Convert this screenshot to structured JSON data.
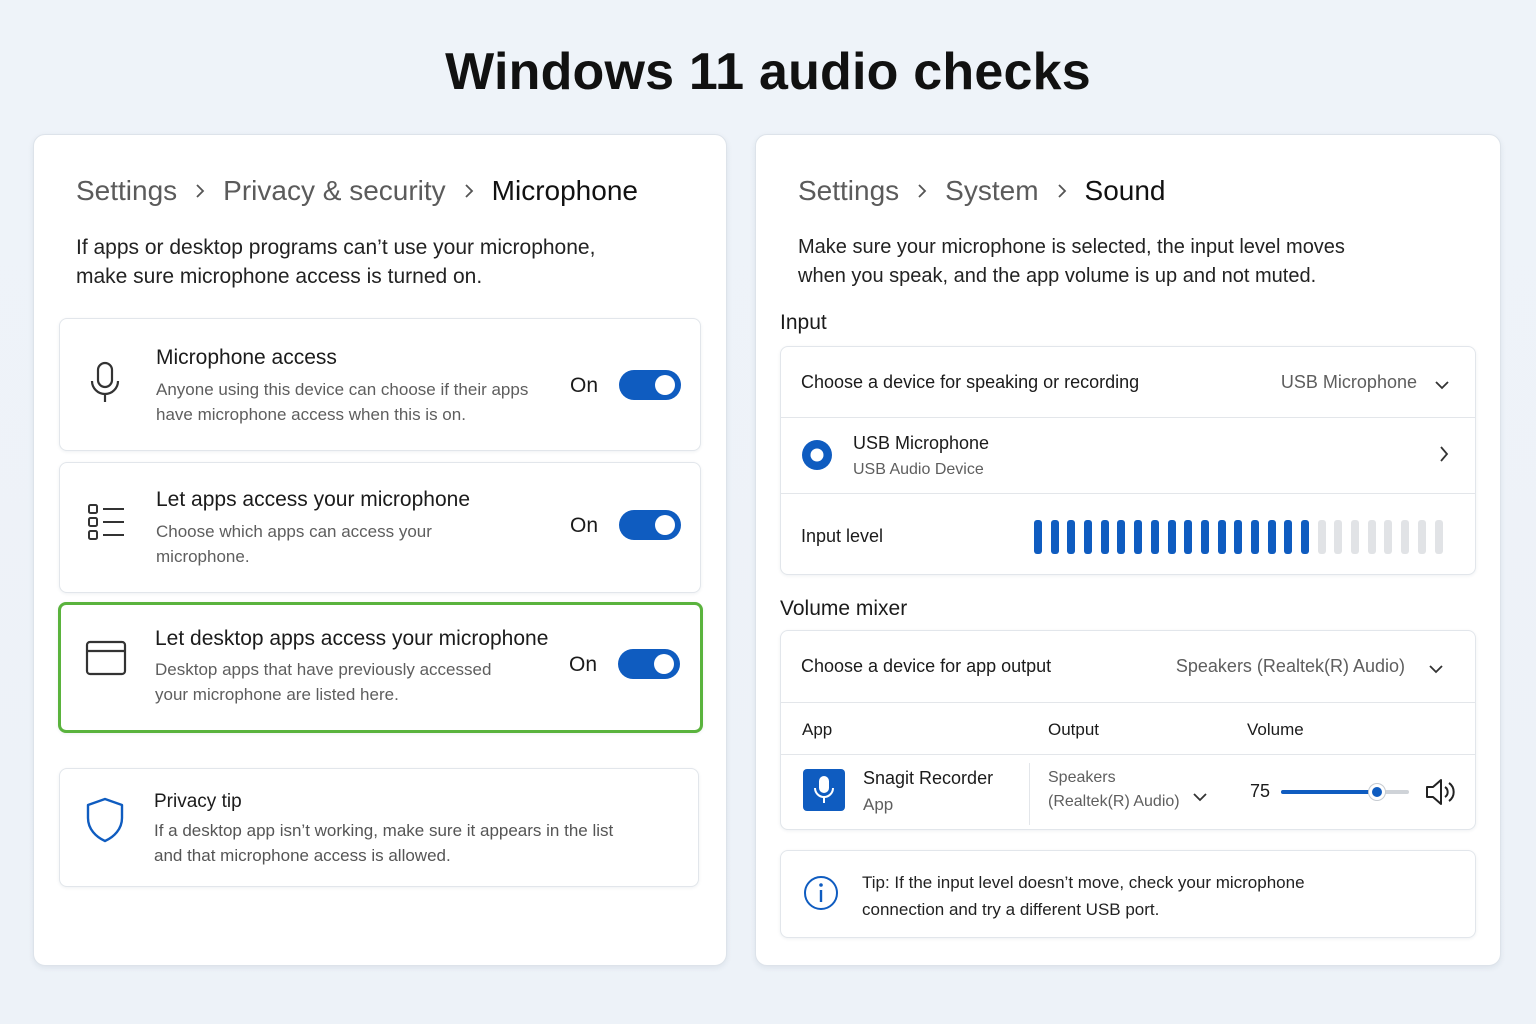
{
  "page": {
    "title": "Windows 11 audio checks"
  },
  "left": {
    "breadcrumb": [
      "Settings",
      "Privacy & security",
      "Microphone"
    ],
    "intro": "If apps or desktop programs can’t use your microphone, make sure microphone access is turned on.",
    "settings": [
      {
        "icon": "microphone-icon",
        "title": "Microphone access",
        "desc": "Anyone using this device can choose if their apps have microphone access when this is on.",
        "state": "On",
        "toggle_on": true,
        "highlighted": false
      },
      {
        "icon": "app-list-icon",
        "title": "Let apps access your microphone",
        "desc": "Choose which apps can access your microphone.",
        "state": "On",
        "toggle_on": true,
        "highlighted": false
      },
      {
        "icon": "desktop-window-icon",
        "title": "Let desktop apps access your microphone",
        "desc": "Desktop apps that have previously accessed your microphone are listed here.",
        "state": "On",
        "toggle_on": true,
        "highlighted": true,
        "highlight_color": "#5ab33d"
      }
    ],
    "privacy_tip": {
      "icon": "shield-icon",
      "title": "Privacy tip",
      "text": "If a desktop app isn’t working, make sure it appears in the list and that microphone access is allowed."
    }
  },
  "right": {
    "breadcrumb": [
      "Settings",
      "System",
      "Sound"
    ],
    "intro": "Make sure your microphone is selected, the input level moves when you speak, and the app volume is up and not muted.",
    "input": {
      "section_label": "Input",
      "device_prompt": "Choose a device for speaking or recording",
      "selected_device": "USB Microphone",
      "device_name": "USB Microphone",
      "device_type": "USB Audio Device",
      "level_label": "Input level",
      "level_active": 17,
      "level_total": 25
    },
    "mixer": {
      "section_label": "Volume mixer",
      "output_prompt": "Choose a device for app output",
      "selected_output": "Speakers (Realtek(R) Audio)",
      "columns": [
        "App",
        "Output",
        "Volume"
      ],
      "app": {
        "name": "Snagit Recorder",
        "kind": "App",
        "output_line1": "Speakers",
        "output_line2": "(Realtek(R) Audio)",
        "volume": "75",
        "volume_fraction": 0.75
      }
    },
    "tip": {
      "icon": "info-icon",
      "text": "Tip: If the input level doesn’t move, check your microphone connection and try a different USB port."
    }
  },
  "colors": {
    "accent": "#0f5cc0",
    "highlight": "#5ab33d",
    "bar_off": "#e1e3e6"
  }
}
